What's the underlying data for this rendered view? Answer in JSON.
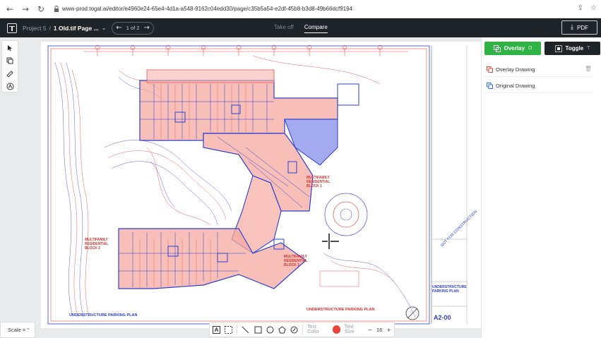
{
  "browser": {
    "back": "←",
    "forward": "→",
    "reload": "↻",
    "url": "www-prod.togal.ai/editor/e4960e24-65e4-4d1a-a548-9162c04edd30/page/c35b5a54-e2df-45b8-b3d8-49b66dcf9194"
  },
  "app": {
    "project": "Project 5",
    "sep": "/",
    "page_title": "1 Old.tif Page ...",
    "pager": "1 of 2",
    "tabs": {
      "takeoff": "Take off",
      "compare": "Compare"
    },
    "pdf_label": "PDF"
  },
  "panel": {
    "overlay_label": "Overlay",
    "overlay_hotkey": "O",
    "toggle_label": "Toggle",
    "toggle_hotkey": "T",
    "layers": [
      {
        "label": "Overlay Drawing",
        "color": "#e9453a"
      },
      {
        "label": "Original Drawing",
        "color": "#2f6fd8"
      }
    ]
  },
  "drawing": {
    "title_left": "UNDERSTRUCTURE PARKING PLAN",
    "title_mid": "UNDERSTRUCTURE PARKING PLAN",
    "block1": "MULTIFAMILY RESIDENTIAL BLOCK 1",
    "block2": "MULTIFAMILY RESIDENTIAL BLOCK 2",
    "block3": "MULTIFAMILY RESIDENTIAL BLOCK 3",
    "title_block_name": "UNDERSTRUCTURE PARKING PLAN",
    "sheet_number": "A2-00",
    "stamp": "NOT FOR CONSTRUCTION"
  },
  "footer": {
    "scale": "Scale = \"",
    "text_color_label": "Text Color",
    "text_size_label": "Text Size",
    "minus": "−",
    "plus": "+",
    "size_value": "16",
    "text_color": "#e9453a"
  }
}
